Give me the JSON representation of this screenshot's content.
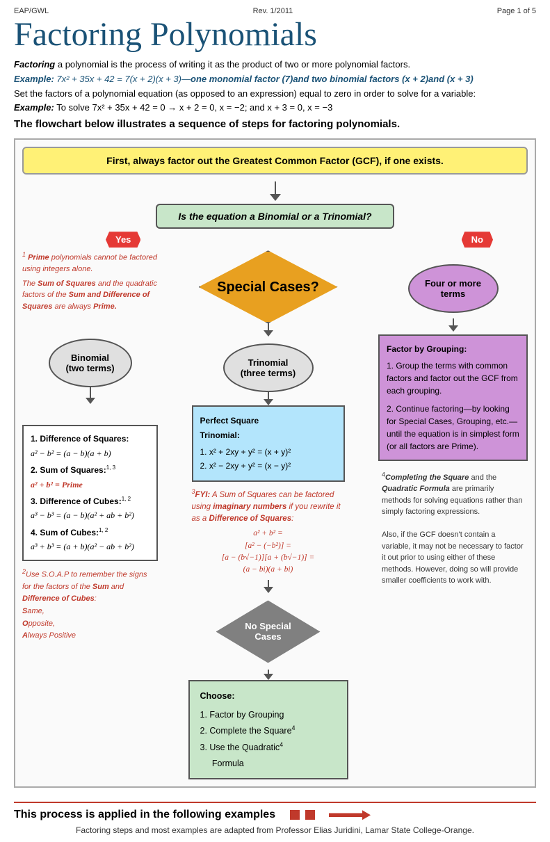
{
  "header": {
    "left": "EAP/GWL",
    "center": "Rev. 1/2011",
    "right": "Page 1 of 5"
  },
  "title": "Factoring Polynomials",
  "intro": {
    "bold_word": "Factoring",
    "text1": " a polynomial is the process of writing it as the product of two or more polynomial factors.",
    "example_label": "Example:",
    "example_eq": " 7x² + 35x + 42 = 7(x + 2)(x + 3)—",
    "example_note": "one monomial factor (7)and two binomial factors (x + 2)and (x + 3)",
    "set_text": "Set the factors of a polynomial equation (as opposed to an expression) equal to zero in order to solve for a variable:",
    "set_example_label": "Example:",
    "set_example": " To solve 7x² + 35x + 42 = 0 → x + 2 = 0,  x = −2; and x + 3 = 0,  x = −3"
  },
  "flowchart_heading": "The flowchart below illustrates a sequence of steps for factoring polynomials.",
  "gcf_box": "First, always factor out the Greatest Common Factor (GCF), if one exists.",
  "diamond_q": "Is the equation a Binomial or a Trinomial?",
  "yes_label": "Yes",
  "no_label": "No",
  "special_cases": "Special Cases?",
  "binomial_oval": "Binomial\n(two terms)",
  "trinomial_oval": "Trinomial\n(three terms)",
  "four_more_oval": "Four or more\nterms",
  "prime_note": {
    "sup": "1",
    "text": "Prime polynomials cannot be factored using integers alone."
  },
  "sum_squares_note": {
    "line1": "The Sum of",
    "line2": "Squares and the",
    "line3": "quadratic factors",
    "line4": "of the Sum and",
    "line5": "Difference of",
    "line6": "Squares are",
    "line7": "always Prime."
  },
  "left_list": {
    "items": [
      {
        "num": "1.",
        "label": "Difference of Squares:",
        "formula": "a² − b² = (a − b)(a + b)"
      },
      {
        "num": "2.",
        "label": "Sum of Squares:",
        "sup": "1, 3",
        "formula": "a² + b² = Prime",
        "formula_red": true
      },
      {
        "num": "3.",
        "label": "Difference of Cubes:",
        "sup": "1, 2",
        "formula": "a³ − b³ = (a − b)(a² + ab + b²)"
      },
      {
        "num": "4.",
        "label": "Sum of Cubes:",
        "sup": "1, 2",
        "formula": "a³ + b³ = (a + b)(a² − ab + b²)"
      }
    ]
  },
  "note2": {
    "sup": "2",
    "text1": "Use S.O.A.P to remember the signs for the factors of the",
    "highlight1": "Sum",
    "text2": " and ",
    "highlight2": "Difference",
    "text3": " of Cubes:",
    "same": "Same,",
    "opposite": "Opposite,",
    "always_positive": "Always Positive"
  },
  "perfect_square": {
    "title": "Perfect Square\nTrinomial:",
    "f1": "1.  x² + 2xy + y² = (x + y)²",
    "f2": "2.  x² − 2xy + y² = (x − y)²"
  },
  "fyi": {
    "sup": "3",
    "text": "FYI:  A Sum of Squares can be factored using imaginary numbers if you rewrite it as a Difference of Squares:",
    "formula1": "a² + b² =",
    "formula2": "[a² − (−b²)] =",
    "formula3": "[a − (b√−1)][a + (b√−1)] =",
    "formula4": "(a − bi)(a + bi)"
  },
  "no_special": "No Special\nCases",
  "choose": {
    "title": "Choose:",
    "items": [
      "Factor by Grouping",
      "Complete the Square",
      "Use the Quadratic\nFormula"
    ],
    "sups": [
      "",
      "4",
      "4"
    ]
  },
  "factor_grouping": {
    "title": "Factor by Grouping:",
    "item1": "1. Group the terms with common factors and factor out the GCF from each grouping.",
    "item2": "2. Continue factoring—by looking for Special Cases, Grouping, etc.—until the equation is in simplest form (or all factors are Prime)."
  },
  "note4": {
    "sup": "4",
    "text1": "Completing the Square",
    "text2": " and the ",
    "text3": "Quadratic Formula",
    "text4": " are primarily methods for solving equations rather than simply factoring expressions.",
    "text5": "\nAlso, if the GCF doesn't contain a variable, it may not be necessary to factor it out prior to using either of these methods. However, doing so will provide smaller coefficients to work with."
  },
  "bottom": {
    "heading": "This process is applied in the following examples",
    "subtext": "Factoring steps and most examples are adapted from Professor Elias Juridini, Lamar State College-Orange."
  }
}
